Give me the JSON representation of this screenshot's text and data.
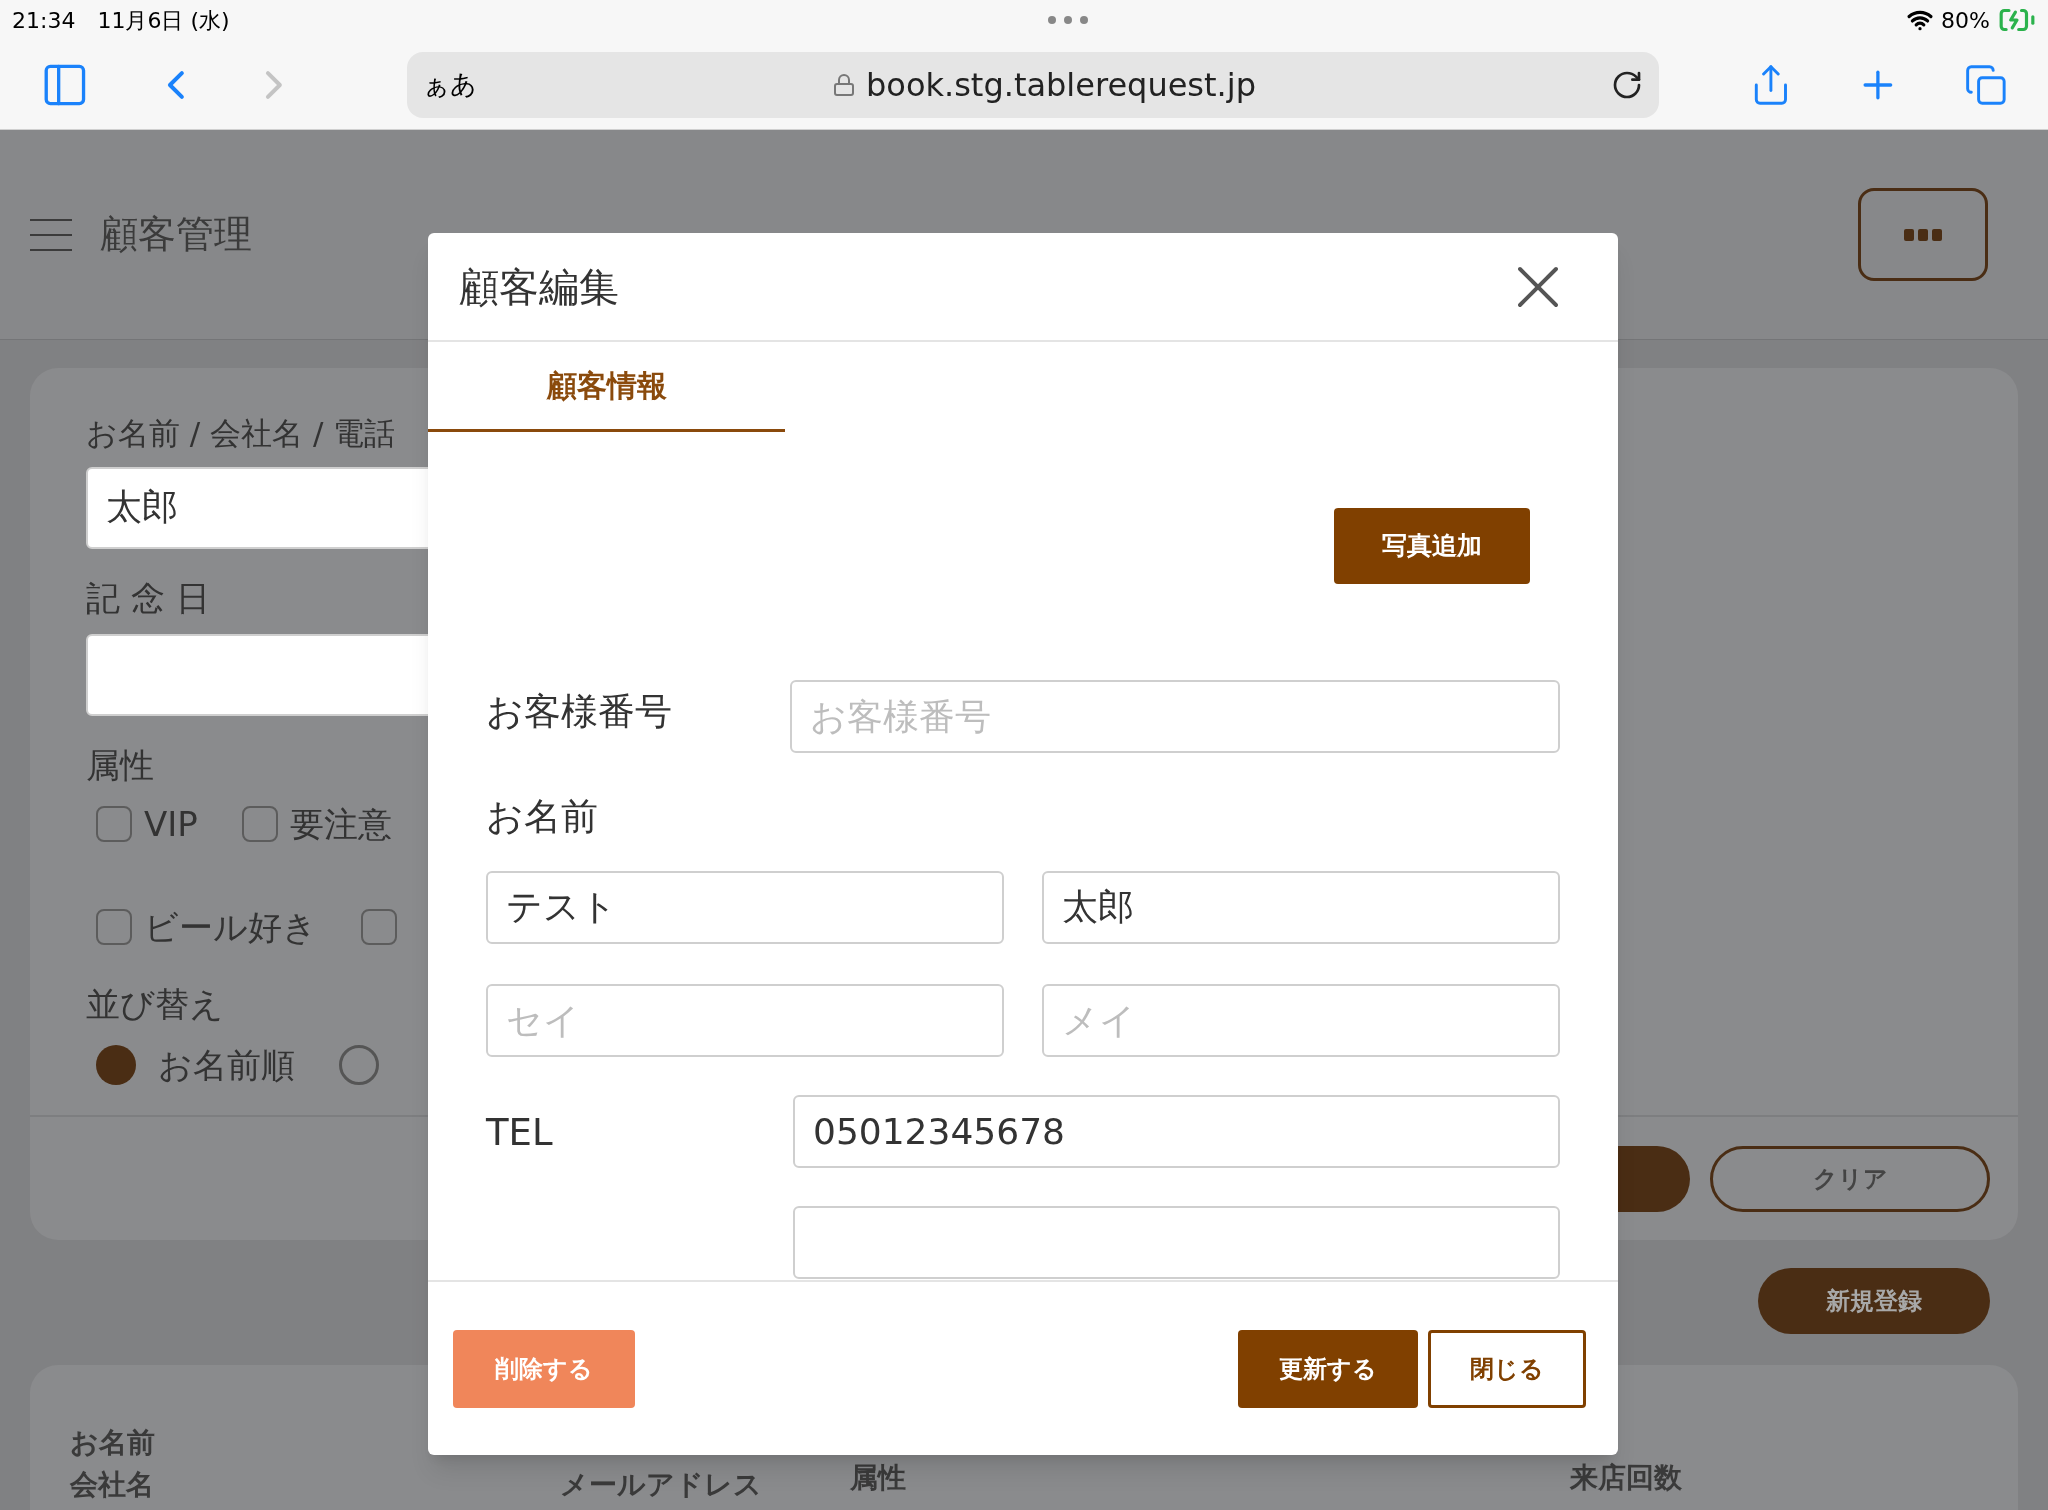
{
  "status_bar": {
    "time": "21:34",
    "date": "11月6日 (水)",
    "battery": "80%"
  },
  "browser": {
    "text_size_label": "ぁあ",
    "url": "book.stg.tablerequest.jp"
  },
  "page": {
    "title": "顧客管理",
    "search": {
      "label": "お名前 / 会社名 / 電話",
      "value": "太郎"
    },
    "anniversary": {
      "label": "記 念 日"
    },
    "attributes": {
      "label": "属性",
      "rows": [
        [
          {
            "label": "VIP",
            "checked": false
          },
          {
            "label": "要注意",
            "checked": false
          }
        ],
        [
          {
            "label": "ビール好き",
            "checked": false
          },
          {
            "checked": false
          }
        ]
      ]
    },
    "sort": {
      "label": "並び替え",
      "options": [
        {
          "label": "お名前順",
          "selected": true
        },
        {
          "selected": false
        }
      ]
    },
    "clear_button": "クリア",
    "new_button": "新規登録",
    "table": {
      "columns": [
        {
          "lines": [
            "お名前",
            "会社名"
          ]
        },
        {
          "lines": [
            "メールアドレス"
          ]
        },
        {
          "lines": [
            "属性"
          ]
        },
        {
          "lines": [
            "来店回数"
          ]
        }
      ]
    }
  },
  "dialog": {
    "title": "顧客編集",
    "tabs": [
      {
        "label": "顧客情報",
        "selected": true
      }
    ],
    "photo_button": "写真追加",
    "customer_number": {
      "label": "お客様番号",
      "placeholder": "お客様番号"
    },
    "name": {
      "label": "お名前",
      "last": {
        "value": "テスト"
      },
      "first": {
        "value": "太郎"
      },
      "last_kana": {
        "placeholder": "セイ"
      },
      "first_kana": {
        "placeholder": "メイ"
      }
    },
    "tel": {
      "label": "TEL",
      "value": "05012345678"
    },
    "delete_button": "削除する",
    "update_button": "更新する",
    "close_button": "閉じる"
  }
}
